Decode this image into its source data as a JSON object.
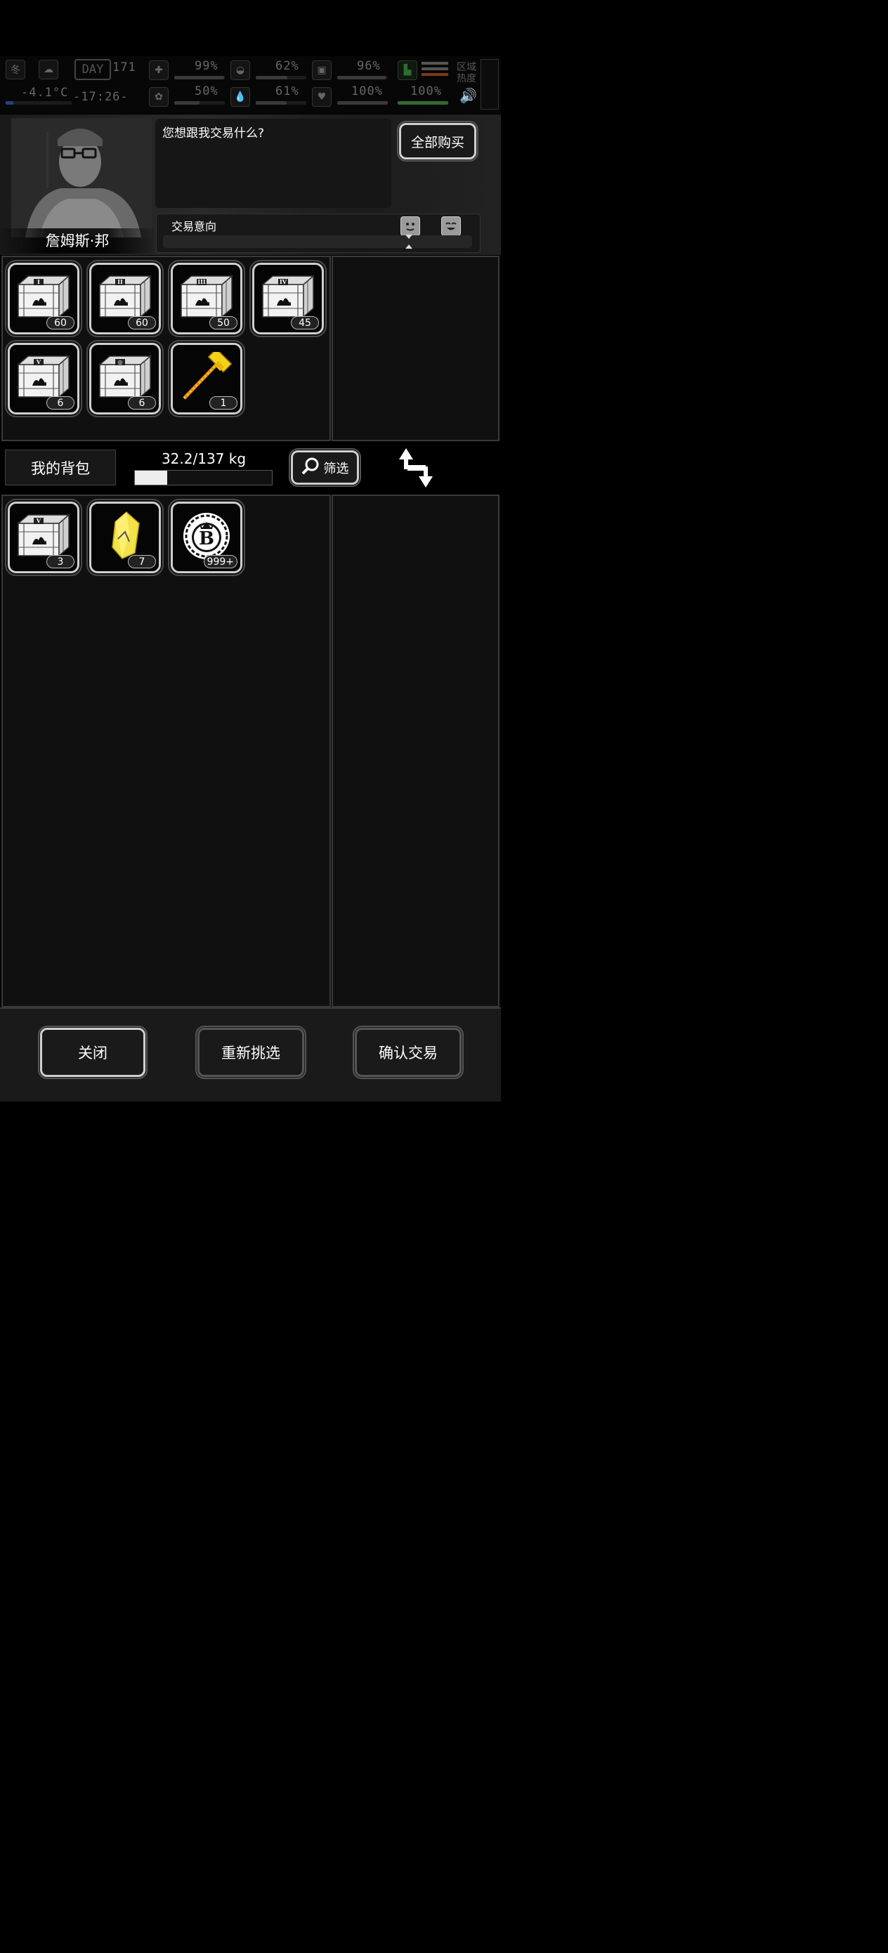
{
  "status": {
    "season": "冬",
    "day_label": "DAY",
    "day": "171",
    "temperature": "-4.1°C",
    "time": "-17:26-",
    "region_heat": "区域\n热度",
    "stats": [
      {
        "icon": "medical-kit-icon",
        "value": "99%",
        "fill": 0.99
      },
      {
        "icon": "stomach-icon",
        "value": "62%",
        "fill": 0.62
      },
      {
        "icon": "energy-icon",
        "value": "96%",
        "fill": 0.96
      },
      {
        "icon": "brain-icon",
        "value": "50%",
        "fill": 0.5
      },
      {
        "icon": "water-drop-icon",
        "value": "61%",
        "fill": 0.61
      },
      {
        "icon": "heart-icon",
        "value": "100%",
        "fill": 1.0
      },
      {
        "icon": "boot-icon",
        "value": "100%",
        "fill": 1.0
      }
    ]
  },
  "npc": {
    "name": "詹姆斯·邦",
    "dialog": "您想跟我交易什么?"
  },
  "buy_all_label": "全部购买",
  "intent_label": "交易意向",
  "merchant_items": [
    {
      "name": "supply-crate-1",
      "numeral": "I",
      "count": "60"
    },
    {
      "name": "supply-crate-2",
      "numeral": "II",
      "count": "60"
    },
    {
      "name": "supply-crate-3",
      "numeral": "III",
      "count": "50"
    },
    {
      "name": "supply-crate-4",
      "numeral": "IV",
      "count": "45"
    },
    {
      "name": "supply-crate-5",
      "numeral": "V",
      "count": "6"
    },
    {
      "name": "special-crate",
      "numeral": "◎",
      "count": "6"
    },
    {
      "name": "golden-hammer",
      "numeral": "",
      "count": "1"
    }
  ],
  "bag": {
    "label": "我的背包",
    "weight": "32.2/137 kg",
    "weight_fill": 0.235,
    "filter_label": "筛选"
  },
  "player_items": [
    {
      "name": "supply-crate-5",
      "numeral": "V",
      "count": "3"
    },
    {
      "name": "yellow-crystal",
      "numeral": "",
      "count": "7"
    },
    {
      "name": "bitcoin-coin",
      "numeral": "B",
      "count": "999+"
    }
  ],
  "footer": {
    "close": "关闭",
    "reselect": "重新挑选",
    "confirm": "确认交易"
  }
}
